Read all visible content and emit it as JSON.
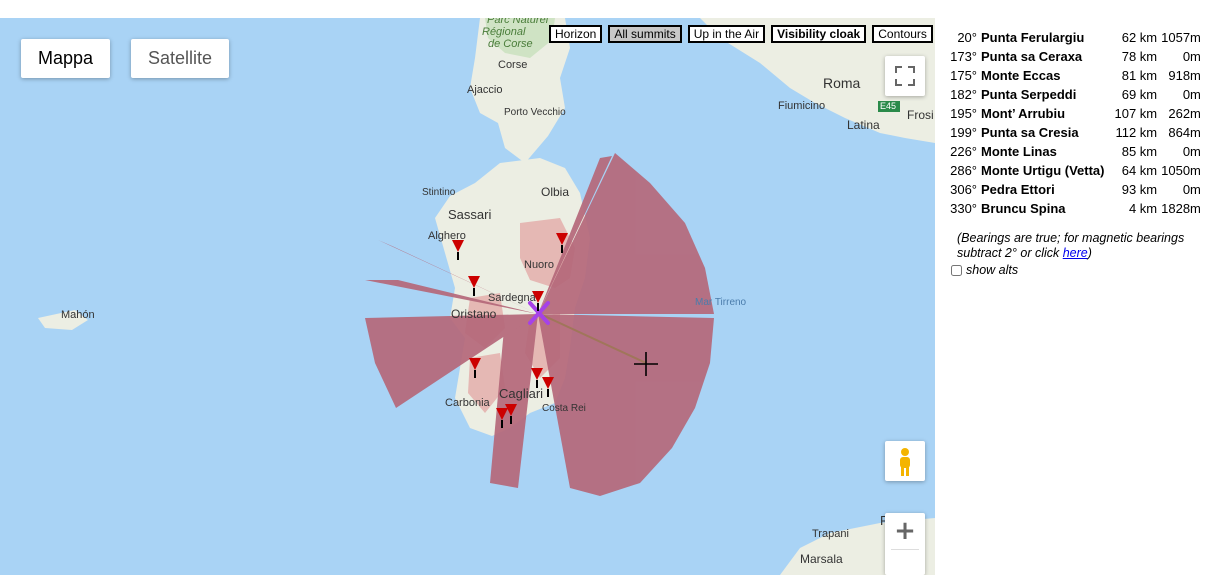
{
  "map": {
    "type_buttons": {
      "map": "Mappa",
      "satellite": "Satellite"
    },
    "overlay_buttons": [
      {
        "label": "Horizon",
        "active": false,
        "bold": false
      },
      {
        "label": "All summits",
        "active": true,
        "bold": false
      },
      {
        "label": "Up in the Air",
        "active": false,
        "bold": false
      },
      {
        "label": "Visibility cloak",
        "active": false,
        "bold": true
      },
      {
        "label": "Contours",
        "active": false,
        "bold": false
      }
    ],
    "places": {
      "parco": "Parc Naturel",
      "regional": "Régional",
      "de_corse": "de Corse",
      "corse": "Corse",
      "ajaccio": "Ajaccio",
      "porto_vecchio": "Porto Vecchio",
      "stintino": "Stintino",
      "sassari": "Sassari",
      "olbia": "Olbia",
      "alghero": "Alghero",
      "nuoro": "Nuoro",
      "sardegna": "Sardegna",
      "oristano": "Oristano",
      "cagliari": "Cagliari",
      "carbonia": "Carbonia",
      "costa_rei": "Costa Rei",
      "mahon": "Mahón",
      "mar_tirreno": "Mar Tirreno",
      "roma": "Roma",
      "fiumicino": "Fiumicino",
      "latina": "Latina",
      "frosi": "Frosi",
      "e45": "E45",
      "trapani": "Trapani",
      "marsala": "Marsala",
      "pa": "Pa"
    },
    "zoom_in_symbol": "+",
    "colors": {
      "sea": "#a9d3f5",
      "cloak": "#b5687a",
      "marker": "#cc0000",
      "observer": "#a642e8"
    }
  },
  "panel": {
    "summits": [
      {
        "bearing": "20°",
        "name": "Punta Ferulargiu",
        "distance": "62 km",
        "alt": "1057m"
      },
      {
        "bearing": "173°",
        "name": "Punta sa Ceraxa",
        "distance": "78 km",
        "alt": "0m"
      },
      {
        "bearing": "175°",
        "name": "Monte Eccas",
        "distance": "81 km",
        "alt": "918m"
      },
      {
        "bearing": "182°",
        "name": "Punta Serpeddi",
        "distance": "69 km",
        "alt": "0m"
      },
      {
        "bearing": "195°",
        "name": "Mont’ Arrubiu",
        "distance": "107 km",
        "alt": "262m"
      },
      {
        "bearing": "199°",
        "name": "Punta sa Cresia",
        "distance": "112 km",
        "alt": "864m"
      },
      {
        "bearing": "226°",
        "name": "Monte Linas",
        "distance": "85 km",
        "alt": "0m"
      },
      {
        "bearing": "286°",
        "name": "Monte Urtigu (Vetta)",
        "distance": "64 km",
        "alt": "1050m"
      },
      {
        "bearing": "306°",
        "name": "Pedra Ettori",
        "distance": "93 km",
        "alt": "0m"
      },
      {
        "bearing": "330°",
        "name": "Bruncu Spina",
        "distance": "4 km",
        "alt": "1828m"
      }
    ],
    "note_text": "(Bearings are true; for magnetic bearings subtract 2° or click ",
    "note_link": "here",
    "note_end": ")",
    "show_alts_label": "show alts"
  }
}
